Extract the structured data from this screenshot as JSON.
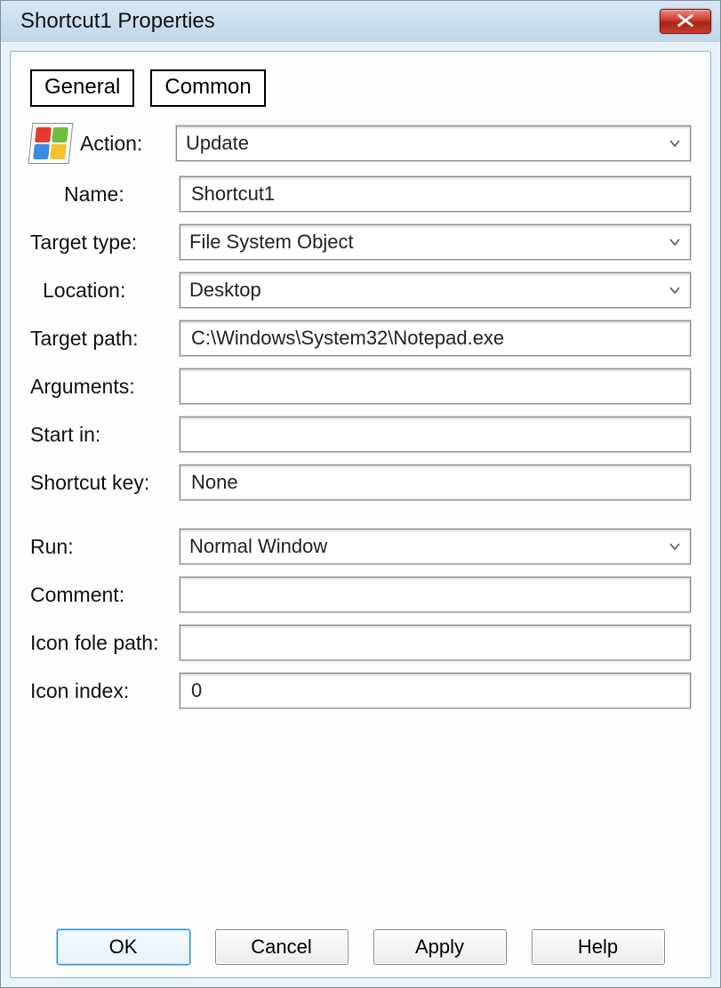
{
  "window": {
    "title": "Shortcut1 Properties"
  },
  "tabs": {
    "general": "General",
    "common": "Common"
  },
  "labels": {
    "action": "Action:",
    "name": "Name:",
    "target_type": "Target type:",
    "location": "Location:",
    "target_path": "Target path:",
    "arguments": "Arguments:",
    "start_in": "Start in:",
    "shortcut_key": "Shortcut key:",
    "run": "Run:",
    "comment": "Comment:",
    "icon_file_path": "Icon fole path:",
    "icon_index": "Icon index:"
  },
  "values": {
    "action": "Update",
    "name": "Shortcut1",
    "target_type": "File System Object",
    "location": "Desktop",
    "target_path": "C:\\Windows\\System32\\Notepad.exe",
    "arguments": "",
    "start_in": "",
    "shortcut_key": "None",
    "run": "Normal Window",
    "comment": "",
    "icon_file_path": "",
    "icon_index": "0"
  },
  "buttons": {
    "ok": "OK",
    "cancel": "Cancel",
    "apply": "Apply",
    "help": "Help"
  },
  "icons": {
    "close": "close-icon",
    "app": "windows-logo-icon",
    "chevron": "chevron-down-icon"
  }
}
